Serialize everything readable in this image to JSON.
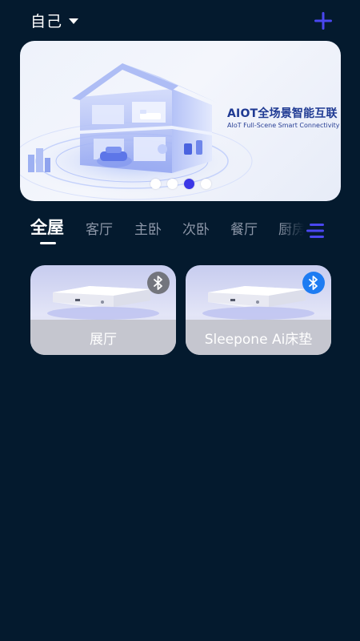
{
  "header": {
    "home_name": "自己",
    "add_icon": "plus-icon"
  },
  "banner": {
    "title": "AIOT全场景智能互联",
    "subtitle": "AIoT Full-Scene Smart Connectivity",
    "pages": 4,
    "active_page": 3
  },
  "rooms": {
    "tabs": [
      "全屋",
      "客厅",
      "主卧",
      "次卧",
      "餐厅",
      "厨房"
    ],
    "active": "全屋",
    "menu_icon": "menu-icon"
  },
  "devices": [
    {
      "name": "展厅",
      "bluetooth_icon": "bluetooth-icon",
      "connected": false
    },
    {
      "name": "Sleepone Ai床垫",
      "bluetooth_icon": "bluetooth-icon",
      "connected": true
    }
  ],
  "colors": {
    "background": "#041a2e",
    "accent": "#3b37e6",
    "bluetooth_connected": "#1e7cf2",
    "bluetooth_disconnected": "#73757d"
  }
}
